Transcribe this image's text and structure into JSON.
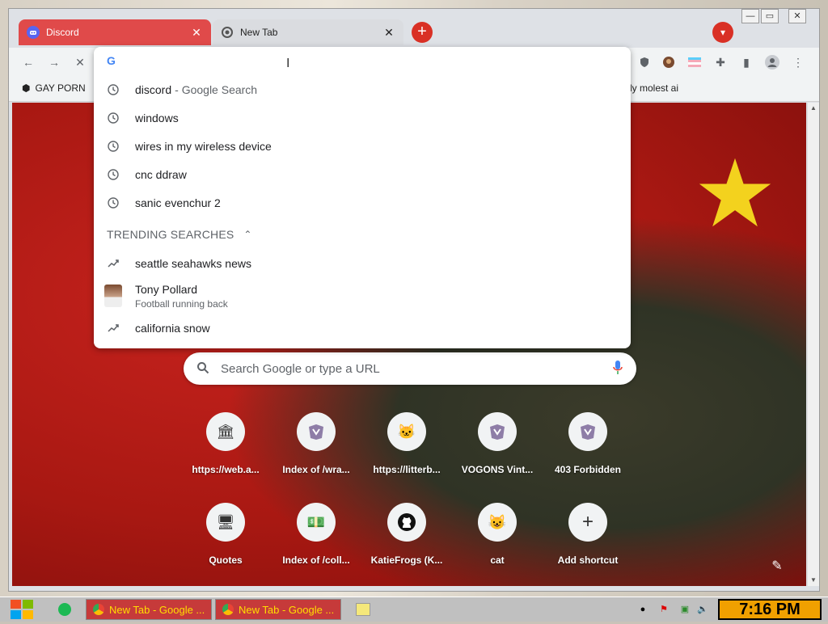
{
  "tabs": [
    {
      "label": "Discord",
      "icon": "discord-icon",
      "active": false
    },
    {
      "label": "New Tab",
      "icon": "chrome-icon",
      "active": true
    }
  ],
  "bookmarks": {
    "left_label": "GAY PORN",
    "right_label": "ly molest ai"
  },
  "omnibox": {
    "value": "",
    "suggestions": [
      {
        "text": "discord",
        "sub": "- Google Search",
        "icon": "history-icon"
      },
      {
        "text": "windows",
        "sub": "",
        "icon": "history-icon"
      },
      {
        "text": "wires in my wireless device",
        "sub": "",
        "icon": "history-icon"
      },
      {
        "text": "cnc ddraw",
        "sub": "",
        "icon": "history-icon"
      },
      {
        "text": "sanic evenchur 2",
        "sub": "",
        "icon": "history-icon"
      }
    ],
    "trending_header": "TRENDING SEARCHES",
    "trending": [
      {
        "text": "seattle seahawks news",
        "sub": "",
        "icon": "trending-icon"
      },
      {
        "text": "Tony Pollard",
        "sub": "Football running back",
        "icon": "avatar"
      },
      {
        "text": "california snow",
        "sub": "",
        "icon": "trending-icon"
      }
    ]
  },
  "search": {
    "placeholder": "Search Google or type a URL"
  },
  "shortcuts": [
    {
      "label": "https://web.a...",
      "icon": "archive-icon"
    },
    {
      "label": "Index of /wra...",
      "icon": "page-icon"
    },
    {
      "label": "https://litterb...",
      "icon": "cat-icon"
    },
    {
      "label": "VOGONS Vint...",
      "icon": "page-icon"
    },
    {
      "label": "403 Forbidden",
      "icon": "page-icon"
    },
    {
      "label": "Quotes",
      "icon": "computer-icon"
    },
    {
      "label": "Index of /coll...",
      "icon": "money-icon"
    },
    {
      "label": "KatieFrogs (K...",
      "icon": "github-icon"
    },
    {
      "label": "cat",
      "icon": "cat-icon"
    },
    {
      "label": "Add shortcut",
      "icon": "plus-icon"
    }
  ],
  "taskbar": {
    "items": [
      {
        "label": "New Tab - Google ..."
      },
      {
        "label": "New Tab - Google ..."
      }
    ],
    "clock": "7:16 PM"
  },
  "colors": {
    "accent": "#d93025",
    "discord_tab": "#e04a4a",
    "clock_bg": "#f0a000",
    "taskbar_text": "#ffde00"
  }
}
